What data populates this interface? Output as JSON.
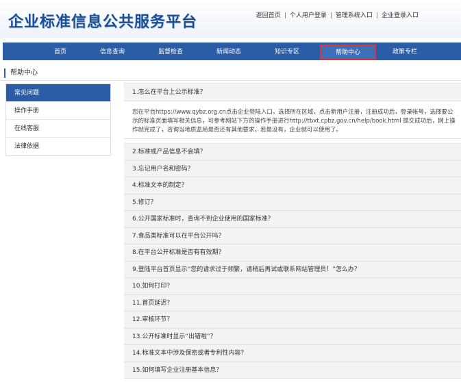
{
  "header": {
    "logo_text": "企业标准信息公共服务平台",
    "top_links": [
      "返回首页",
      "个人用户登录",
      "管理系统入口",
      "企业登录入口"
    ]
  },
  "nav": {
    "items": [
      "首页",
      "信息查询",
      "监督检查",
      "新闻动态",
      "知识专区",
      "帮助中心",
      "政策专栏"
    ],
    "active_index": 5
  },
  "section_title": "帮助中心",
  "sidebar": {
    "items": [
      "常见问题",
      "操作手册",
      "在线客服",
      "法律依据"
    ],
    "active_index": 0
  },
  "faq": {
    "first_question": "1.怎么在平台上公示标准？",
    "first_answer": "您在平台https://www.qybz.org.cn点击企业登陆入口，选择所在区域，点击新用户注册，注册成功后，登录帐号，选择要公示的标准页面填写相关信息，可参考网站下方的操作手册进行http://tbxt.cpbz.gov.cn/help/book.html 提交成功后，网上操作就完成了，咨询当地质监局是否还有其他要求，若是没有，企业就可以使用了。",
    "questions": [
      "2.标准或产品信息不会填？",
      "3.忘记用户名和密码？",
      "4.标准文本的制定？",
      "5.修订？",
      "6.公开国家标准时，查询不到企业使用的国家标准？",
      "7.食品类标准可以在平台公开吗？",
      "8.在平台公开标准是否有有效期？",
      "9.登陆平台首页显示“您的请求过于频繁，请稍后再试或联系网站管理员！”怎么办？",
      "10.如何打印？",
      "11.首页延迟？",
      "12.审核环节？",
      "13.公开标准时显示“出错啦”？",
      "14.标准文本中涉及保密或者专利性内容？",
      "15.如何填写企业注册基本信息？"
    ]
  }
}
